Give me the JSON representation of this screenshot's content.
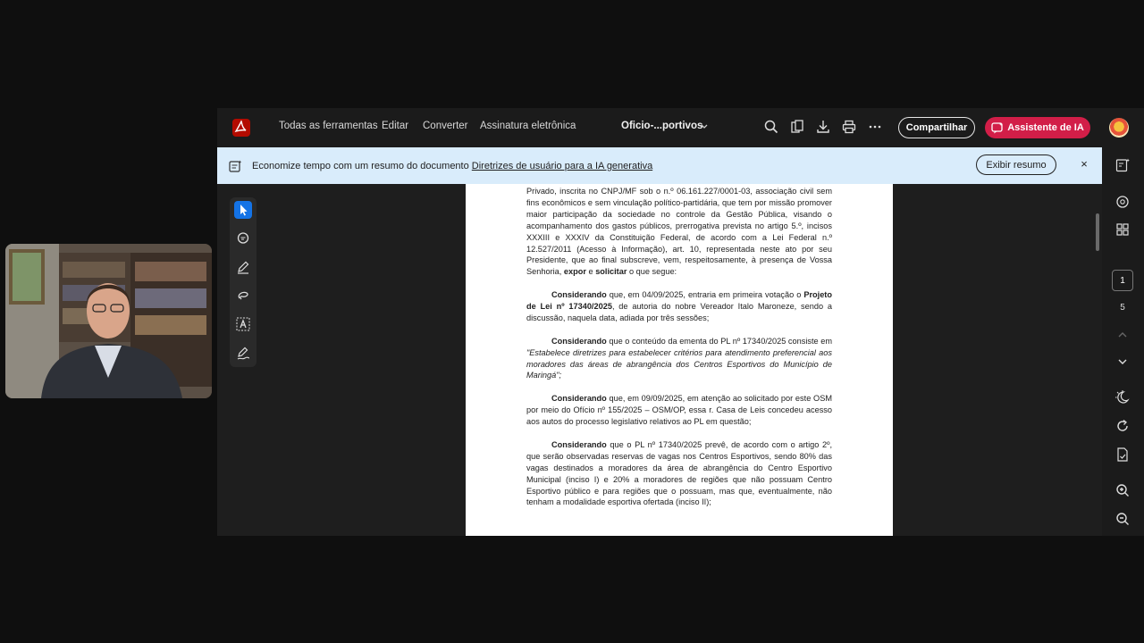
{
  "toolbar": {
    "menu": [
      "Todas as ferramentas",
      "Editar",
      "Converter",
      "Assinatura eletrônica"
    ],
    "filename": "Oficio-...portivos",
    "share_label": "Compartilhar",
    "ai_label": "Assistente de IA",
    "icons": [
      "search-icon",
      "organize-pages-icon",
      "download-icon",
      "print-icon",
      "more-icon"
    ]
  },
  "banner": {
    "text": "Economize tempo com um resumo do documento",
    "link": "Diretrizes de usuário para a IA generativa",
    "button": "Exibir resumo",
    "close": "×"
  },
  "left_tools": [
    "select-icon",
    "comment-icon",
    "draw-icon",
    "lasso-icon",
    "text-recognition-icon",
    "sign-icon"
  ],
  "document": {
    "p1": {
      "pre": "Privado, inscrita no CNPJ/MF sob o n.º 06.161.227/0001-03, associação civil sem fins econômicos e sem vinculação político-partidária, que tem por missão promover maior participação da sociedade no controle da Gestão Pública, visando o acompanhamento dos gastos públicos, prerrogativa prevista no artigo 5.º, incisos XXXIII e XXXIV da Constituição Federal, de acordo com a Lei Federal n.º 12.527/2011 (Acesso à Informação), art. 10, representada neste ato por seu Presidente, que ao final subscreve, vem, respeitosamente, à presença de Vossa Senhoria,",
      "b1": "expor",
      "mid": "e",
      "b2": "solicitar",
      "post": "o que segue:"
    },
    "p2": {
      "b1": "Considerando",
      "mid": "que, em 04/09/2025, entraria em primeira votação o",
      "b2": "Projeto de Lei nº 17340/2025",
      "post": ", de autoria do nobre Vereador Italo Maroneze, sendo a discussão, naquela data, adiada por três sessões;"
    },
    "p3": {
      "b1": "Considerando",
      "mid": "que o conteúdo da ementa do PL nº 17340/2025 consiste em",
      "italic": "\"Estabelece diretrizes para estabelecer critérios para atendimento preferencial aos moradores das áreas de abrangência dos Centros Esportivos do Município de Maringá\";"
    },
    "p4": {
      "b1": "Considerando",
      "rest": "que, em 09/09/2025, em atenção ao solicitado por este OSM por meio do Ofício nº 155/2025 – OSM/OP, essa r. Casa de Leis concedeu acesso aos autos do processo legislativo relativos ao PL em questão;"
    },
    "p5": {
      "b1": "Considerando",
      "rest": "que o PL nº 17340/2025 prevê, de acordo com o artigo 2º, que serão observadas reservas de vagas nos Centros Esportivos, sendo 80% das vagas destinados a moradores da área de abrangência do Centro Esportivo Municipal (inciso I) e 20% a moradores de regiões que não possuam Centro Esportivo público e para regiões que o possuam, mas que, eventualmente, não tenham a modalidade esportiva ofertada (inciso II);"
    }
  },
  "right_rail": {
    "icons": [
      "edit-pdf-icon",
      "comments-panel-icon",
      "thumbnails-icon",
      "scroll-up-icon",
      "scroll-down-icon",
      "theme-icon",
      "rotate-icon",
      "page-extract-icon",
      "zoom-in-icon",
      "zoom-out-icon"
    ],
    "current_page": "1",
    "total_pages": "5"
  },
  "colors": {
    "accent": "#1473e6",
    "ai_button": "#d21e48",
    "banner": "#d9ecfb"
  }
}
